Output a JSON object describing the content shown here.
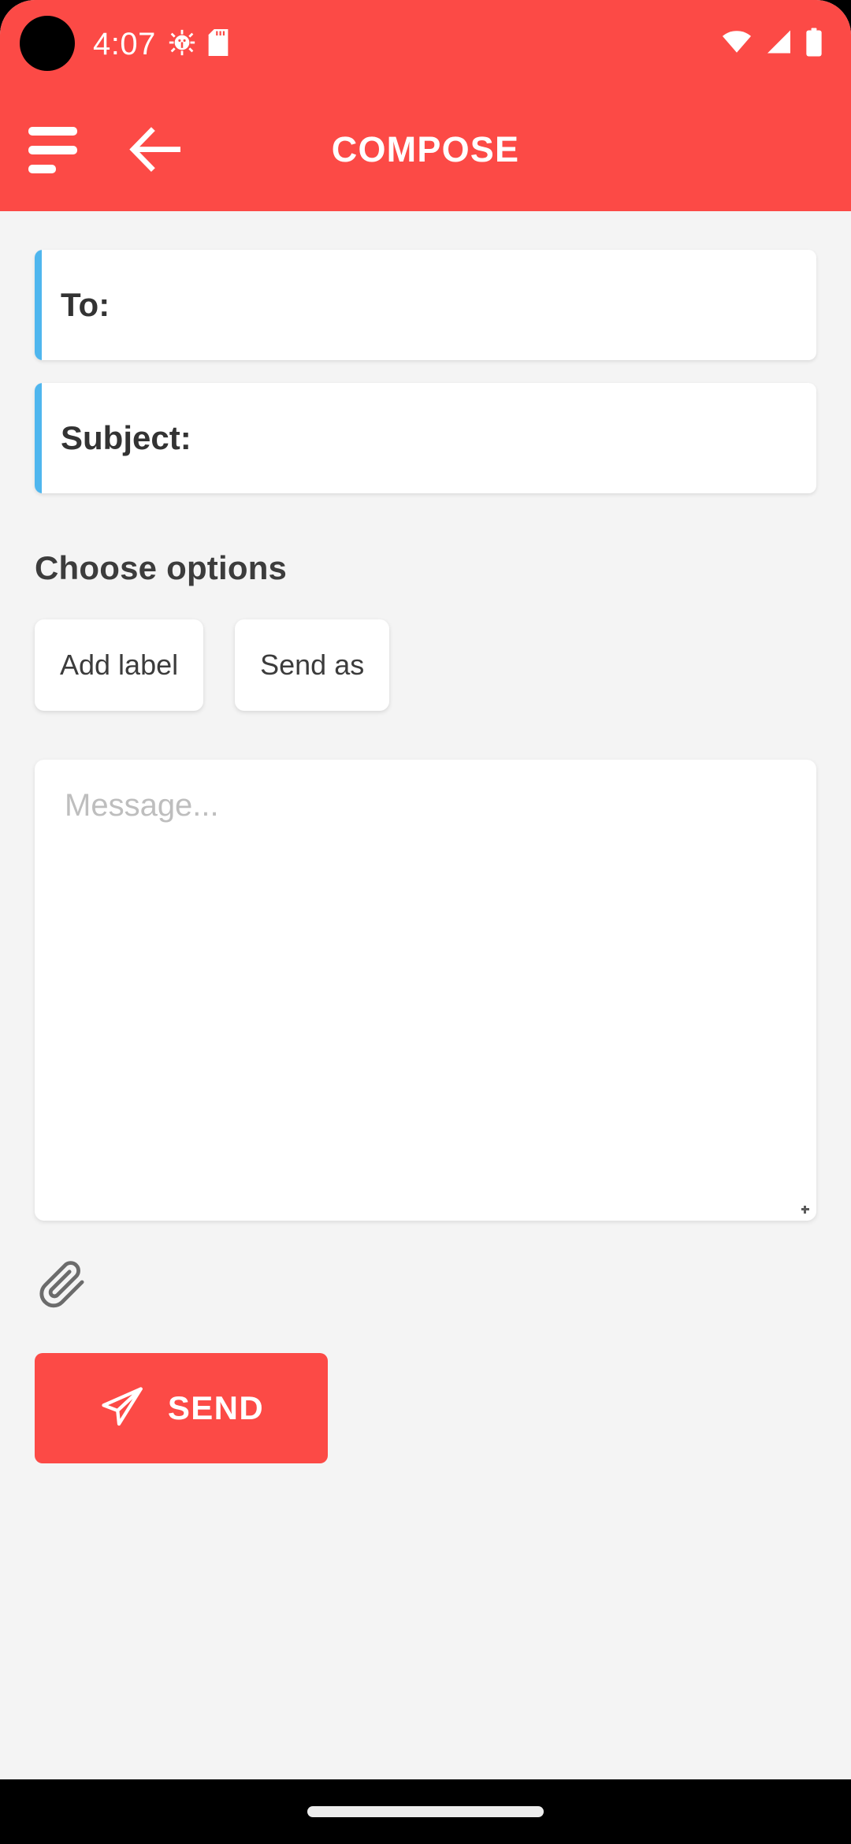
{
  "status_bar": {
    "time": "4:07",
    "icons_left": [
      "android-debug-icon",
      "sd-card-icon"
    ],
    "icons_right": [
      "wifi-icon",
      "cellular-signal-icon",
      "battery-full-icon"
    ],
    "background_color": "#FC4A46",
    "foreground_color": "#FFFFFF"
  },
  "toolbar": {
    "title": "COMPOSE",
    "menu_icon": "hamburger-menu-icon",
    "back_icon": "arrow-left-icon",
    "background_color": "#FC4A46"
  },
  "form": {
    "to": {
      "label": "To:",
      "value": "",
      "accent_color": "#4FB6EE"
    },
    "subject": {
      "label": "Subject:",
      "value": "",
      "accent_color": "#4FB6EE"
    },
    "message": {
      "placeholder": "Message...",
      "value": ""
    }
  },
  "options": {
    "heading": "Choose options",
    "chips": [
      {
        "label": "Add label"
      },
      {
        "label": "Send as"
      }
    ]
  },
  "attachment": {
    "icon": "paperclip-icon"
  },
  "send": {
    "label": "SEND",
    "icon": "paper-plane-icon",
    "background_color": "#FC4A46",
    "text_color": "#FFFFFF"
  },
  "navigation_bar": {
    "gesture_pill": "home-gesture-pill",
    "background_color": "#000000"
  },
  "theme": {
    "page_background": "#F4F4F4",
    "card_background": "#FFFFFF",
    "primary": "#FC4A46",
    "accent_blue": "#4FB6EE",
    "text_primary": "#333333",
    "text_placeholder": "#BEBEBE"
  }
}
